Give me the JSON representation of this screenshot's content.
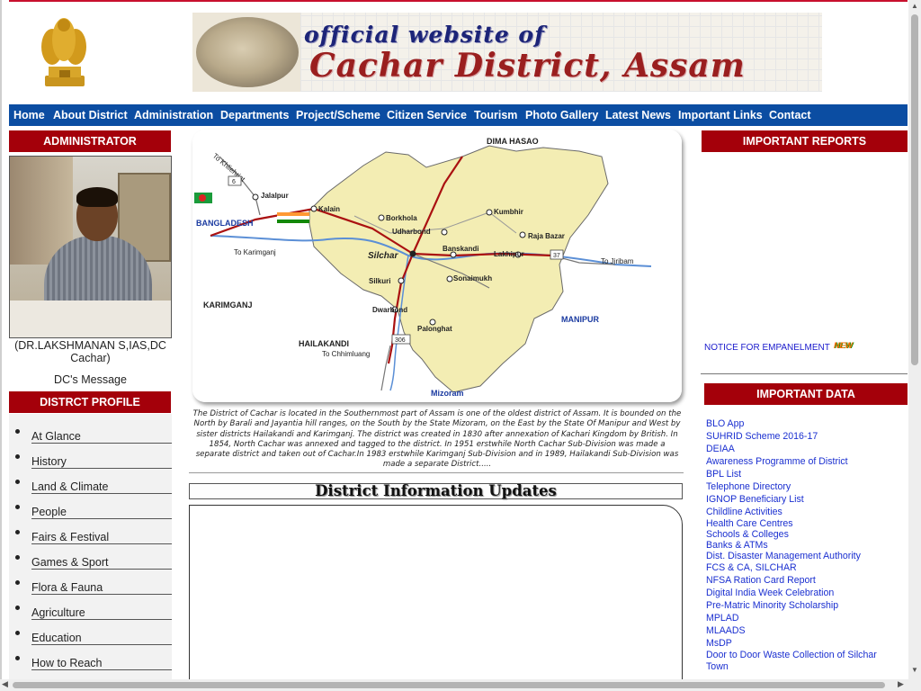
{
  "header": {
    "banner_line1": "official website of",
    "banner_line2": "Cachar District, Assam"
  },
  "nav": [
    {
      "label": "Home"
    },
    {
      "label": "About District"
    },
    {
      "label": "Administration"
    },
    {
      "label": "Departments"
    },
    {
      "label": "Project/Scheme"
    },
    {
      "label": "Citizen Service"
    },
    {
      "label": "Tourism"
    },
    {
      "label": "Photo Gallery"
    },
    {
      "label": "Latest News"
    },
    {
      "label": "Important Links"
    },
    {
      "label": "Contact"
    }
  ],
  "left": {
    "admin_heading": "ADMINISTRATOR",
    "admin_caption": "(DR.LAKSHMANAN S,IAS,DC Cachar)",
    "dc_message": "DC's Message",
    "profile_heading": "DISTRCT PROFILE",
    "profile_items": [
      {
        "label": "At Glance"
      },
      {
        "label": "History"
      },
      {
        "label": "Land & Climate"
      },
      {
        "label": "People"
      },
      {
        "label": "Fairs & Festival"
      },
      {
        "label": "Games & Sport"
      },
      {
        "label": "Flora & Fauna"
      },
      {
        "label": "Agriculture"
      },
      {
        "label": "Education"
      },
      {
        "label": "How to Reach"
      }
    ]
  },
  "map": {
    "places": {
      "dima_hasao": "DIMA HASAO",
      "to_khliehriat": "To Khliehriat",
      "jalalpur": "Jalalpur",
      "kalain": "Kalain",
      "bangladesh": "BANGLADESH",
      "borkhola": "Borkhola",
      "kumbhir": "Kumbhir",
      "udharbond": "Udharbond",
      "raja_bazar": "Raja Bazar",
      "to_karimganj": "To Karimganj",
      "banskandi": "Banskandi",
      "lakhipur": "Lakhipur",
      "silchar": "Silchar",
      "to_jiribam": "To Jiribam",
      "silkuri": "Silkuri",
      "sonaimukh": "Sonaimukh",
      "karimganj": "KARIMGANJ",
      "dwarbond": "Dwarbond",
      "manipur": "MANIPUR",
      "palonghat": "Palonghat",
      "hailakandi": "HAILAKANDI",
      "to_chhimluang": "To Chhimluang",
      "mizoram": "Mizoram",
      "nh6": "6",
      "nh37": "37",
      "nh306": "306"
    },
    "description": "The District of Cachar is located in the Southernmost part of Assam is one of the oldest district of Assam. It is bounded on the North by Barali and Jayantia hill ranges, on the South by the State Mizoram, on the East by the State Of Manipur and West by sister districts Hailakandi and Karimganj. The district was created in 1830 after annexation of Kachari Kingdom by British. In 1854, North Cachar was annexed and tagged to the district. In 1951 erstwhile North Cachar Sub-Division was made a separate district and taken out of Cachar.In 1983 erstwhile Karimganj Sub-Division and in 1989, Hailakandi Sub-Division was made a separate District....."
  },
  "center": {
    "updates_heading": "District Information Updates"
  },
  "right": {
    "reports_heading": "IMPORTANT REPORTS",
    "notice": "NOTICE FOR EMPANELMENT",
    "new_badge": "NEW",
    "data_heading": "IMPORTANT DATA",
    "links": [
      {
        "label": "BLO App"
      },
      {
        "label": "SUHRID Scheme 2016-17"
      },
      {
        "label": "DEIAA"
      },
      {
        "label": "Awareness Programme of District"
      },
      {
        "label": "BPL List"
      },
      {
        "label": "Telephone Directory"
      },
      {
        "label": "IGNOP Beneficiary List"
      },
      {
        "label": "Childline Activities"
      },
      {
        "label": "Health Care Centres"
      },
      {
        "label": "Schools & Colleges"
      },
      {
        "label": "Banks & ATMs"
      },
      {
        "label": "Dist. Disaster Management Authority"
      },
      {
        "label": "FCS & CA, SILCHAR"
      },
      {
        "label": "NFSA Ration Card Report"
      },
      {
        "label": "Digital India Week Celebration"
      },
      {
        "label": "Pre-Matric Minority Scholarship"
      },
      {
        "label": "MPLAD"
      },
      {
        "label": "MLAADS"
      },
      {
        "label": "MsDP"
      },
      {
        "label": "Door to Door Waste Collection of Silchar Town"
      }
    ]
  },
  "colors": {
    "nav_bg": "#0b4da2",
    "section_red": "#a4000a",
    "link_blue": "#1a2fd0",
    "top_border": "#c8102e"
  }
}
